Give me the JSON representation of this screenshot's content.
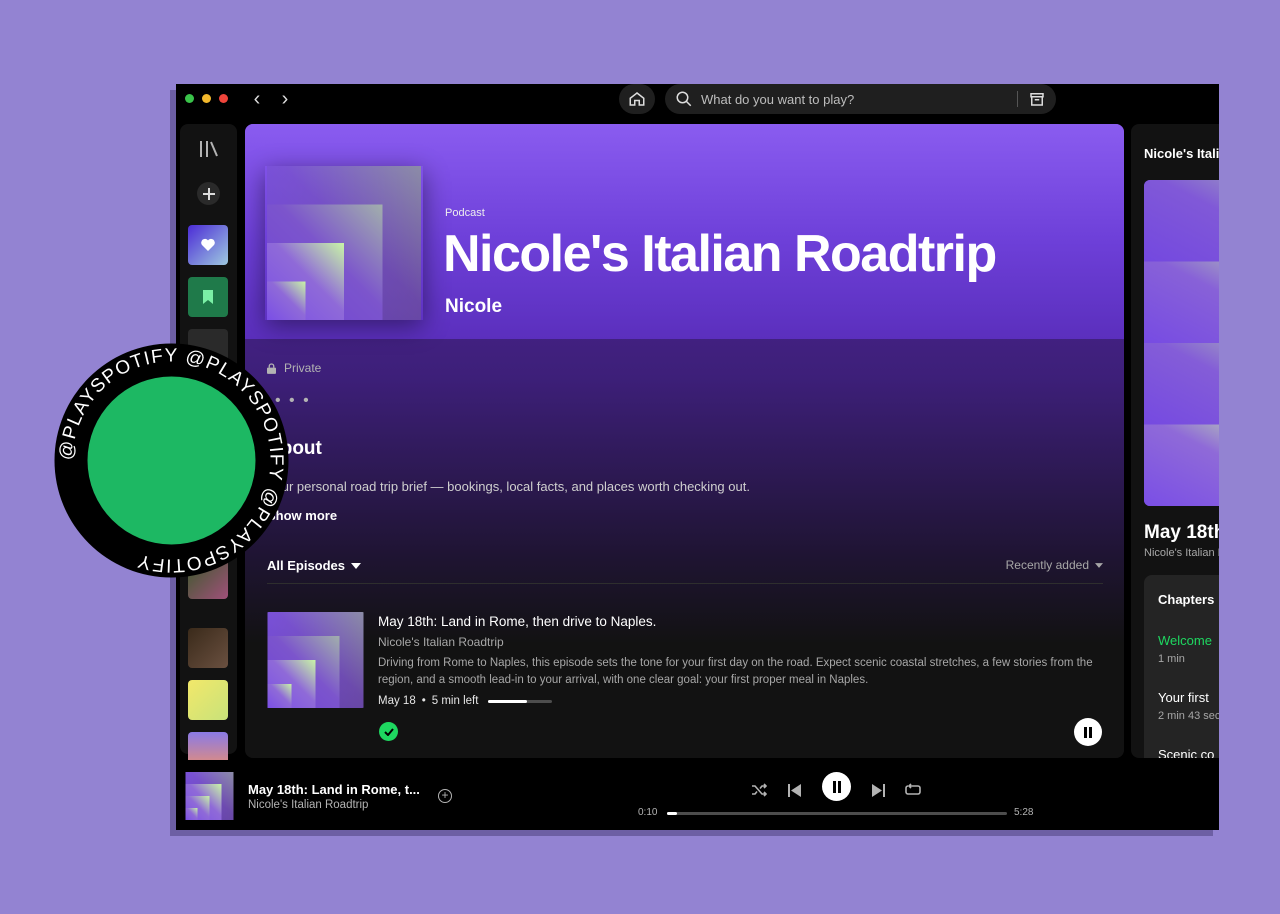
{
  "window": {
    "nav": {
      "back_label": "‹",
      "forward_label": "›"
    },
    "search": {
      "placeholder": "What do you want to play?"
    }
  },
  "sidebar": {
    "icons": [
      "library-icon",
      "add-icon",
      "liked-songs",
      "saved-episodes",
      "folder-icon"
    ]
  },
  "podcast": {
    "kicker": "Podcast",
    "title": "Nicole's Italian Roadtrip",
    "author": "Nicole",
    "visibility": "Private",
    "more_label": "• • •",
    "about_heading": "About",
    "about_text": "Your personal road trip brief — bookings, local facts, and places worth checking out.",
    "show_more": "Show more"
  },
  "episodes": {
    "filter_label": "All Episodes",
    "sort_label": "Recently added",
    "items": [
      {
        "title": "May 18th: Land in Rome, then drive to Naples.",
        "show": "Nicole's Italian Roadtrip",
        "description": "Driving from Rome to Naples, this episode sets the tone for your first day on the road. Expect scenic coastal stretches, a few stories from the region, and a smooth lead-in to your arrival, with one clear goal: your first proper meal in Naples.",
        "date": "May 18",
        "separator": "•",
        "remaining": "5 min left",
        "progress_fraction": 0.6
      }
    ]
  },
  "right_panel": {
    "title": "Nicole's Italian Roadtrip",
    "episode_title": "May 18th",
    "episode_show": "Nicole's Italian Roadtrip",
    "chapters_heading": "Chapters",
    "chapters": [
      {
        "title": "Welcome",
        "duration": "1 min",
        "active": true
      },
      {
        "title": "Your first",
        "duration": "2 min 43 sec",
        "active": false
      },
      {
        "title": "Scenic co",
        "duration": "",
        "active": false
      }
    ]
  },
  "player": {
    "title": "May 18th: Land in Rome, t...",
    "show": "Nicole's Italian Roadtrip",
    "elapsed": "0:10",
    "duration": "5:28",
    "progress_fraction": 0.03
  },
  "sticker": {
    "text": "@PLAYSPOTIFY @PLAYSPOTIFY @PLAYSPOTIFY"
  },
  "colors": {
    "page_bg": "#9383d2",
    "accent_green": "#1ed760",
    "hero_purple": "#7c4ce8",
    "sticker_green": "#1db863"
  }
}
